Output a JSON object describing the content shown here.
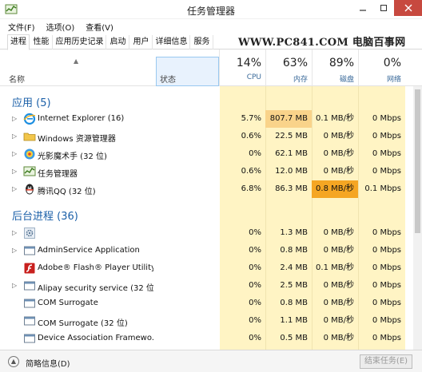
{
  "window": {
    "title": "任务管理器"
  },
  "menu": [
    "文件(F)",
    "选项(O)",
    "查看(V)"
  ],
  "tabs": [
    "进程",
    "性能",
    "应用历史记录",
    "启动",
    "用户",
    "详细信息",
    "服务"
  ],
  "watermark": "WWW.PC841.COM 电脑百事网",
  "columns": {
    "name": "名称",
    "status": "状态",
    "cpu": {
      "pct": "14%",
      "label": "CPU"
    },
    "memory": {
      "pct": "63%",
      "label": "内存"
    },
    "disk": {
      "pct": "89%",
      "label": "磁盘"
    },
    "network": {
      "pct": "0%",
      "label": "网络"
    }
  },
  "groups": {
    "apps": "应用 (5)",
    "background": "后台进程 (36)"
  },
  "apps": [
    {
      "name": "Internet Explorer (16)",
      "icon": "ie-icon",
      "cpu": "5.7%",
      "mem": "807.7 MB",
      "disk": "0.1 MB/秒",
      "net": "0 Mbps",
      "mem_hl": true,
      "disk_hl": false
    },
    {
      "name": "Windows 资源管理器",
      "icon": "explorer-icon",
      "cpu": "0.6%",
      "mem": "22.5 MB",
      "disk": "0 MB/秒",
      "net": "0 Mbps",
      "mem_hl": false,
      "disk_hl": false
    },
    {
      "name": "光影魔术手 (32 位)",
      "icon": "photo-app-icon",
      "cpu": "0%",
      "mem": "62.1 MB",
      "disk": "0 MB/秒",
      "net": "0 Mbps",
      "mem_hl": false,
      "disk_hl": false
    },
    {
      "name": "任务管理器",
      "icon": "task-manager-icon",
      "cpu": "0.6%",
      "mem": "12.0 MB",
      "disk": "0 MB/秒",
      "net": "0 Mbps",
      "mem_hl": false,
      "disk_hl": false
    },
    {
      "name": "腾讯QQ (32 位)",
      "icon": "qq-icon",
      "cpu": "6.8%",
      "mem": "86.3 MB",
      "disk": "0.8 MB/秒",
      "net": "0.1 Mbps",
      "mem_hl": false,
      "disk_hl": true
    }
  ],
  "background": [
    {
      "name": "",
      "icon": "gear-icon",
      "expand": true,
      "cpu": "0%",
      "mem": "1.3 MB",
      "disk": "0 MB/秒",
      "net": "0 Mbps"
    },
    {
      "name": "AdminService Application",
      "icon": "service-icon",
      "expand": true,
      "cpu": "0%",
      "mem": "0.8 MB",
      "disk": "0 MB/秒",
      "net": "0 Mbps"
    },
    {
      "name": "Adobe® Flash® Player Utility",
      "icon": "flash-icon",
      "expand": false,
      "cpu": "0%",
      "mem": "2.4 MB",
      "disk": "0.1 MB/秒",
      "net": "0 Mbps"
    },
    {
      "name": "Alipay security service (32 位)",
      "icon": "service-icon",
      "expand": true,
      "cpu": "0%",
      "mem": "2.5 MB",
      "disk": "0 MB/秒",
      "net": "0 Mbps"
    },
    {
      "name": "COM Surrogate",
      "icon": "service-icon",
      "expand": false,
      "cpu": "0%",
      "mem": "0.8 MB",
      "disk": "0 MB/秒",
      "net": "0 Mbps"
    },
    {
      "name": "COM Surrogate (32 位)",
      "icon": "service-icon",
      "expand": false,
      "cpu": "0%",
      "mem": "1.1 MB",
      "disk": "0 MB/秒",
      "net": "0 Mbps"
    },
    {
      "name": "Device Association Framewo...",
      "icon": "service-icon",
      "expand": false,
      "cpu": "0%",
      "mem": "0.5 MB",
      "disk": "0 MB/秒",
      "net": "0 Mbps"
    }
  ],
  "footer": {
    "brief": "简略信息(D)",
    "end_task": "结束任务(E)"
  },
  "colors": {
    "accent": "#1a5fa8",
    "heat_light": "#fff4c4",
    "heat_medium": "#f9d38a",
    "heat_high": "#f5a623",
    "close_button": "#c7493f"
  }
}
